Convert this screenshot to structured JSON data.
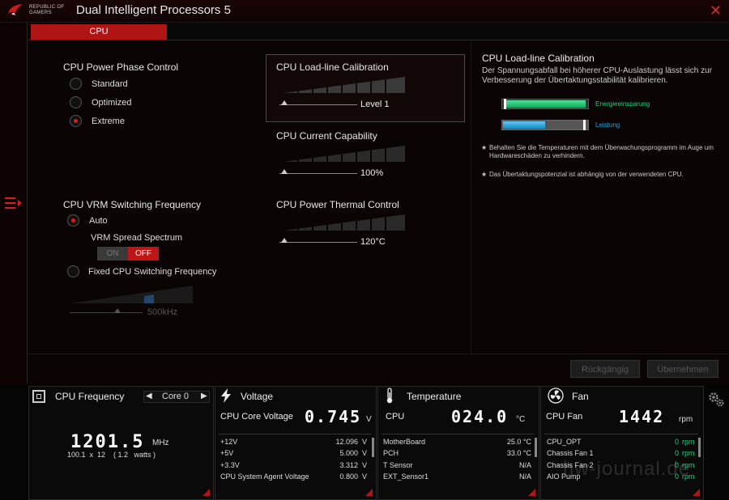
{
  "titlebar": {
    "brand_line1": "REPUBLIC OF",
    "brand_line2": "GAMERS",
    "title": "Dual Intelligent Processors 5"
  },
  "tabs": [
    {
      "label": "CPU",
      "active": true
    }
  ],
  "power_phase": {
    "title": "CPU Power Phase Control",
    "options": [
      {
        "label": "Standard"
      },
      {
        "label": "Optimized"
      },
      {
        "label": "Extreme"
      }
    ],
    "selected": "Extreme"
  },
  "vrm": {
    "title": "CPU VRM Switching Frequency",
    "auto_label": "Auto",
    "spread_label": "VRM Spread Spectrum",
    "on_label": "ON",
    "off_label": "OFF",
    "fixed_label": "Fixed CPU Switching Frequency",
    "freq_value": "500kHz",
    "selected": "Auto",
    "spread_state": "OFF"
  },
  "llc": {
    "title": "CPU Load-line Calibration",
    "value": "Level 1"
  },
  "current_cap": {
    "title": "CPU Current Capability",
    "value": "100%"
  },
  "thermal": {
    "title": "CPU Power Thermal Control",
    "value": "120°C"
  },
  "description": {
    "title": "CPU Load-line Calibration",
    "text": "Der Spannungsabfall bei höherer CPU-Auslastung lässt sich zur Verbesserung der Übertaktungsstabilität kalibrieren.",
    "bar1_label": "Energieeinsparung",
    "bar2_label": "Leistung",
    "note1": "Behalten Sie die Temperaturen mit dem Überwachungsprogramm im Auge um Hardwareschäden zu verhindern.",
    "note2": "Das Übertaktungspotenzial ist abhängig von der verwendeten CPU.",
    "colors": {
      "green": "#1fd37a",
      "blue": "#2aa3d8"
    }
  },
  "actions": {
    "undo": "Rückgängig",
    "apply": "Übernehmen"
  },
  "monitor": {
    "freq": {
      "title": "CPU Frequency",
      "selector": "Core 0",
      "value": "1201.5",
      "unit": "MHz",
      "detail": "100.1  x  12    ( 1.2   watts )"
    },
    "voltage": {
      "title": "Voltage",
      "main_label": "CPU Core Voltage",
      "main_value": "0.745",
      "main_unit": "V",
      "rows": [
        {
          "label": "+12V",
          "value": "12.096",
          "unit": "V"
        },
        {
          "label": "+5V",
          "value": "5.000",
          "unit": "V"
        },
        {
          "label": "+3.3V",
          "value": "3.312",
          "unit": "V"
        },
        {
          "label": "CPU System Agent Voltage",
          "value": "0.800",
          "unit": "V"
        }
      ]
    },
    "temperature": {
      "title": "Temperature",
      "main_label": "CPU",
      "main_value": "024.0",
      "main_unit": "°C",
      "rows": [
        {
          "label": "MotherBoard",
          "value": "25.0 °C"
        },
        {
          "label": "PCH",
          "value": "33.0 °C"
        },
        {
          "label": "T Sensor",
          "value": "N/A"
        },
        {
          "label": "EXT_Sensor1",
          "value": "N/A"
        }
      ]
    },
    "fan": {
      "title": "Fan",
      "main_label": "CPU Fan",
      "main_value": "1442",
      "main_unit": "rpm",
      "rows": [
        {
          "label": "CPU_OPT",
          "value": "0",
          "unit": "rpm"
        },
        {
          "label": "Chassis Fan 1",
          "value": "0",
          "unit": "rpm"
        },
        {
          "label": "Chassis Fan 2",
          "value": "0",
          "unit": "rpm"
        },
        {
          "label": "AIO Pump",
          "value": "0",
          "unit": "rpm"
        }
      ]
    },
    "watermark": "hw-journal.de"
  }
}
